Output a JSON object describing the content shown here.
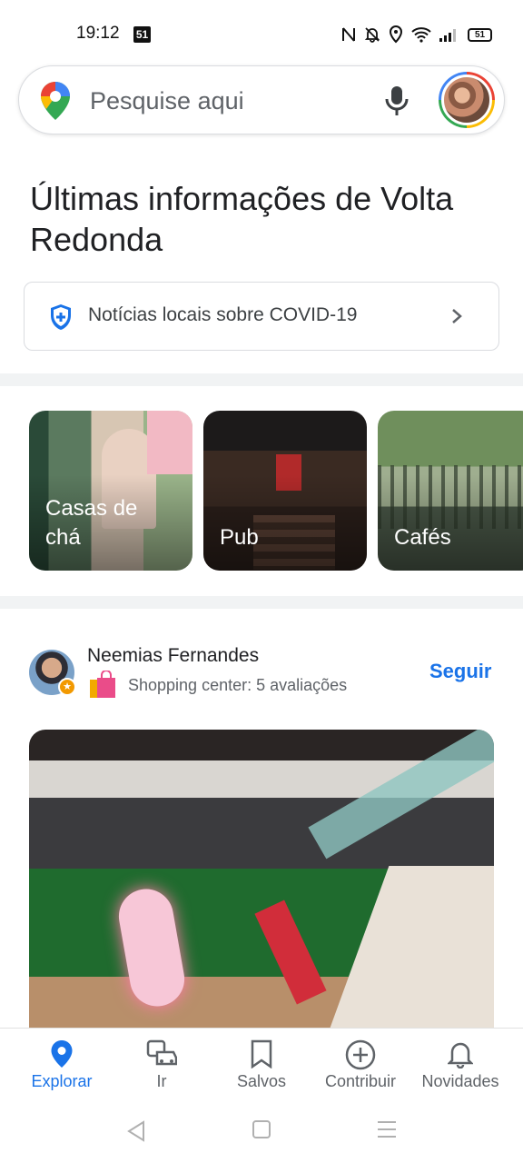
{
  "status_bar": {
    "time": "19:12",
    "notification_badge": "51",
    "battery": "51"
  },
  "search": {
    "placeholder": "Pesquise aqui"
  },
  "latest": {
    "title": "Últimas informações de Volta Redonda"
  },
  "covid": {
    "label": "Notícias locais sobre COVID-19"
  },
  "categories": [
    {
      "label": "Casas de chá"
    },
    {
      "label": "Pub"
    },
    {
      "label": "Cafés"
    }
  ],
  "review": {
    "name": "Neemias Fernandes",
    "meta": "Shopping center: 5 avaliações",
    "follow": "Seguir"
  },
  "nav": [
    {
      "label": "Explorar",
      "icon": "pin-icon",
      "active": true
    },
    {
      "label": "Ir",
      "icon": "car-icon"
    },
    {
      "label": "Salvos",
      "icon": "bookmark-icon"
    },
    {
      "label": "Contribuir",
      "icon": "add-circle-icon"
    },
    {
      "label": "Novidades",
      "icon": "bell-icon"
    }
  ],
  "colors": {
    "accent": "#1a73e8",
    "text": "#202124",
    "secondary": "#5f6368"
  }
}
